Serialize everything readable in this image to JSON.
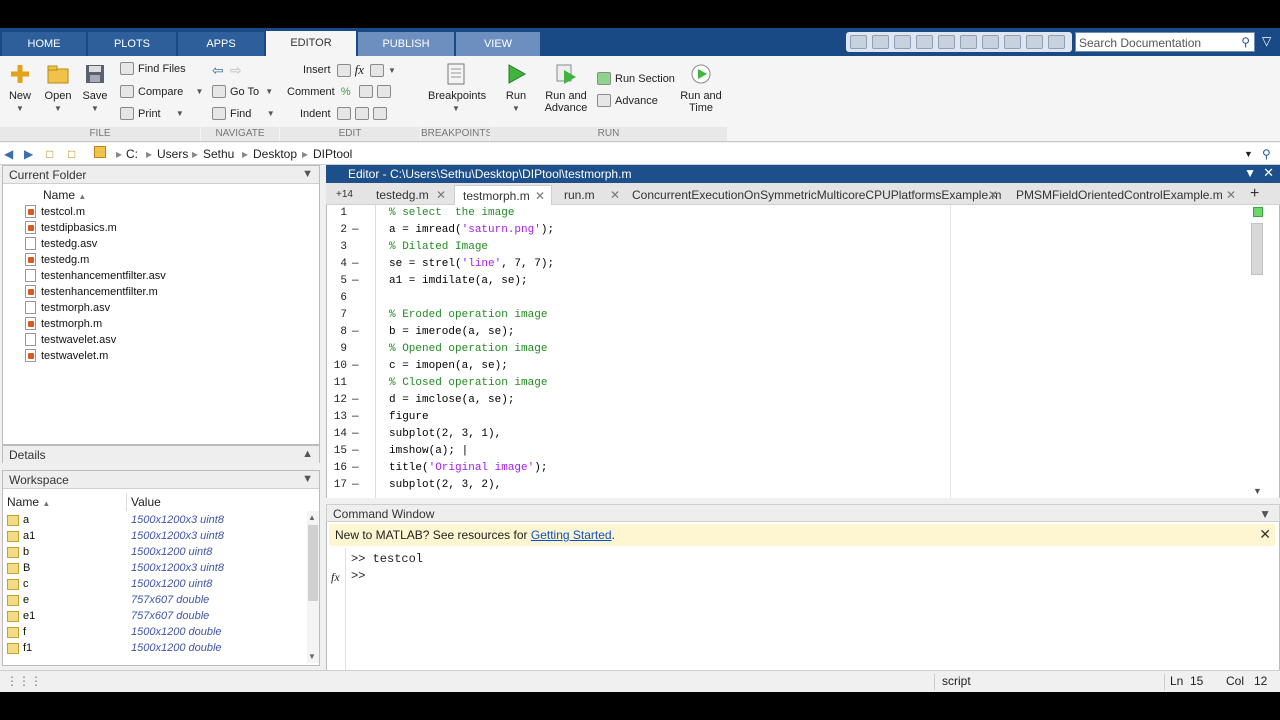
{
  "tabs": [
    "HOME",
    "PLOTS",
    "APPS",
    "EDITOR",
    "PUBLISH",
    "VIEW"
  ],
  "search": {
    "placeholder": "Search Documentation"
  },
  "ribbon": {
    "new": "New",
    "open": "Open",
    "save": "Save",
    "find_files": "Find Files",
    "compare": "Compare",
    "print": "Print",
    "go_to": "Go To",
    "find": "Find",
    "insert": "Insert",
    "comment": "Comment",
    "indent": "Indent",
    "breakpoints": "Breakpoints",
    "run": "Run",
    "run_and_advance_1": "Run and",
    "run_and_advance_2": "Advance",
    "run_section": "Run Section",
    "advance": "Advance",
    "run_and_time_1": "Run and",
    "run_and_time_2": "Time",
    "groups": {
      "file": "FILE",
      "navigate": "NAVIGATE",
      "edit": "EDIT",
      "breakpoints": "BREAKPOINTS",
      "run": "RUN"
    }
  },
  "path": {
    "segments": [
      "C:",
      "Users",
      "Sethu",
      "Desktop",
      "DIPtool"
    ]
  },
  "current_folder": {
    "title": "Current Folder",
    "column": "Name",
    "files": [
      {
        "name": "testcol.m",
        "type": "m"
      },
      {
        "name": "testdipbasics.m",
        "type": "m"
      },
      {
        "name": "testedg.asv",
        "type": "asv"
      },
      {
        "name": "testedg.m",
        "type": "m"
      },
      {
        "name": "testenhancementfilter.asv",
        "type": "asv"
      },
      {
        "name": "testenhancementfilter.m",
        "type": "m"
      },
      {
        "name": "testmorph.asv",
        "type": "asv"
      },
      {
        "name": "testmorph.m",
        "type": "m"
      },
      {
        "name": "testwavelet.asv",
        "type": "asv"
      },
      {
        "name": "testwavelet.m",
        "type": "m"
      }
    ]
  },
  "details": {
    "title": "Details"
  },
  "workspace": {
    "title": "Workspace",
    "col_name": "Name",
    "col_value": "Value",
    "vars": [
      {
        "name": "a",
        "value": "1500x1200x3 uint8"
      },
      {
        "name": "a1",
        "value": "1500x1200x3 uint8"
      },
      {
        "name": "b",
        "value": "1500x1200 uint8"
      },
      {
        "name": "B",
        "value": "1500x1200x3 uint8"
      },
      {
        "name": "c",
        "value": "1500x1200 uint8"
      },
      {
        "name": "e",
        "value": "757x607 double"
      },
      {
        "name": "e1",
        "value": "757x607 double"
      },
      {
        "name": "f",
        "value": "1500x1200 double"
      },
      {
        "name": "f1",
        "value": "1500x1200 double"
      }
    ]
  },
  "editor": {
    "title": "Editor - C:\\Users\\Sethu\\Desktop\\DIPtool\\testmorph.m",
    "overflow": "+14",
    "tabs": [
      "testedg.m",
      "testmorph.m",
      "run.m",
      "ConcurrentExecutionOnSymmetricMulticoreCPUPlatformsExample.m",
      "PMSMFieldOrientedControlExample.m"
    ],
    "lines": [
      {
        "n": "1",
        "dash": "",
        "parts": [
          {
            "t": "% select  the image",
            "c": "cmt"
          }
        ]
      },
      {
        "n": "2",
        "dash": "—",
        "parts": [
          {
            "t": "a = imread(",
            "c": ""
          },
          {
            "t": "'saturn.png'",
            "c": "str"
          },
          {
            "t": ");",
            "c": ""
          }
        ]
      },
      {
        "n": "3",
        "dash": "",
        "parts": [
          {
            "t": "% Dilated Image",
            "c": "cmt"
          }
        ]
      },
      {
        "n": "4",
        "dash": "—",
        "parts": [
          {
            "t": "se = strel(",
            "c": ""
          },
          {
            "t": "'line'",
            "c": "str"
          },
          {
            "t": ", 7, 7);",
            "c": ""
          }
        ]
      },
      {
        "n": "5",
        "dash": "—",
        "parts": [
          {
            "t": "a1 = imdilate(a, se);",
            "c": ""
          }
        ]
      },
      {
        "n": "6",
        "dash": "",
        "parts": [
          {
            "t": "",
            "c": ""
          }
        ]
      },
      {
        "n": "7",
        "dash": "",
        "parts": [
          {
            "t": "% Eroded operation image",
            "c": "cmt"
          }
        ]
      },
      {
        "n": "8",
        "dash": "—",
        "parts": [
          {
            "t": "b = imerode(a, se);",
            "c": ""
          }
        ]
      },
      {
        "n": "9",
        "dash": "",
        "parts": [
          {
            "t": "% Opened operation image",
            "c": "cmt"
          }
        ]
      },
      {
        "n": "10",
        "dash": "—",
        "parts": [
          {
            "t": "c = imopen(a, se);",
            "c": ""
          }
        ]
      },
      {
        "n": "11",
        "dash": "",
        "parts": [
          {
            "t": "% Closed operation image",
            "c": "cmt"
          }
        ]
      },
      {
        "n": "12",
        "dash": "—",
        "parts": [
          {
            "t": "d = imclose(a, se);",
            "c": ""
          }
        ]
      },
      {
        "n": "13",
        "dash": "—",
        "parts": [
          {
            "t": "figure",
            "c": ""
          }
        ]
      },
      {
        "n": "14",
        "dash": "—",
        "parts": [
          {
            "t": "subplot(2, 3, 1),",
            "c": ""
          }
        ]
      },
      {
        "n": "15",
        "dash": "—",
        "parts": [
          {
            "t": "imshow(a); |",
            "c": ""
          }
        ]
      },
      {
        "n": "16",
        "dash": "—",
        "parts": [
          {
            "t": "title(",
            "c": ""
          },
          {
            "t": "'Original image'",
            "c": "str"
          },
          {
            "t": ");",
            "c": ""
          }
        ]
      },
      {
        "n": "17",
        "dash": "—",
        "parts": [
          {
            "t": "subplot(2, 3, 2),",
            "c": ""
          }
        ]
      }
    ]
  },
  "command_window": {
    "title": "Command Window",
    "notice_text": "New to MATLAB? See resources for ",
    "notice_link": "Getting Started",
    "notice_end": ".",
    "line1": ">> testcol",
    "prompt": ">>",
    "fx": "fx"
  },
  "statusbar": {
    "mode": "script",
    "ln_label": "Ln",
    "ln": "15",
    "col_label": "Col",
    "col": "12"
  }
}
